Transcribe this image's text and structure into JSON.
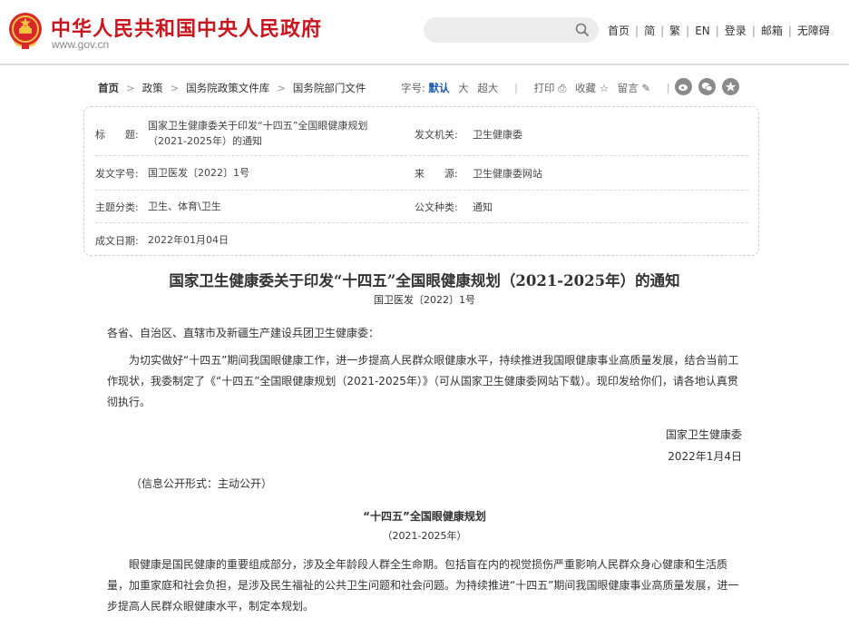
{
  "header": {
    "site_title": "中华人民共和国中央人民政府",
    "site_domain": "www.gov.cn",
    "nav": [
      "首页",
      "简",
      "繁",
      "EN",
      "登录",
      "邮箱",
      "无障碍"
    ],
    "colors": {
      "brand_red": "#c8161e",
      "accent_blue": "#1a57b5"
    }
  },
  "breadcrumb": [
    "首页",
    "政策",
    "国务院政策文件库",
    "国务院部门文件"
  ],
  "toolbar": {
    "font_label": "字号:",
    "font_default": "默认",
    "font_large": "大",
    "font_xlarge": "超大",
    "print": "打印",
    "favorite": "收藏",
    "comment": "留言"
  },
  "share_icons": [
    "weibo-icon",
    "wechat-icon",
    "qzone-icon"
  ],
  "info": {
    "title_label": "标　　题:",
    "title_value": "国家卫生健康委关于印发“十四五”全国眼健康规划（2021-2025年）的通知",
    "issuer_label": "发文机关:",
    "issuer_value": "卫生健康委",
    "number_label": "发文字号:",
    "number_value": "国卫医发〔2022〕1号",
    "source_label": "来　　源:",
    "source_value": "卫生健康委网站",
    "category_label": "主题分类:",
    "category_value": "卫生、体育\\卫生",
    "type_label": "公文种类:",
    "type_value": "通知",
    "date_label": "成文日期:",
    "date_value": "2022年01月04日"
  },
  "document": {
    "title": "国家卫生健康委关于印发“十四五”全国眼健康规划（2021-2025年）的通知",
    "number": "国卫医发〔2022〕1号",
    "salutation": "各省、自治区、直辖市及新疆生产建设兵团卫生健康委：",
    "body": "为切实做好“十四五”期间我国眼健康工作，进一步提高人民群众眼健康水平，持续推进我国眼健康事业高质量发展，结合当前工作现状，我委制定了《“十四五”全国眼健康规划（2021-2025年）》（可从国家卫生健康委网站下载）。现印发给你们，请各地认真贯彻执行。",
    "signature": "国家卫生健康委",
    "sign_date": "2022年1月4日",
    "disclosure": "（信息公开形式：主动公开）",
    "plan_title": "“十四五”全国眼健康规划",
    "plan_years": "（2021-2025年）",
    "plan_intro": "眼健康是国民健康的重要组成部分，涉及全年龄段人群全生命期。包括盲在内的视觉损伤严重影响人民群众身心健康和生活质量，加重家庭和社会负担，是涉及民生福祉的公共卫生问题和社会问题。为持续推进“十四五”期间我国眼健康事业高质量发展，进一步提高人民群众眼健康水平，制定本规划。"
  }
}
